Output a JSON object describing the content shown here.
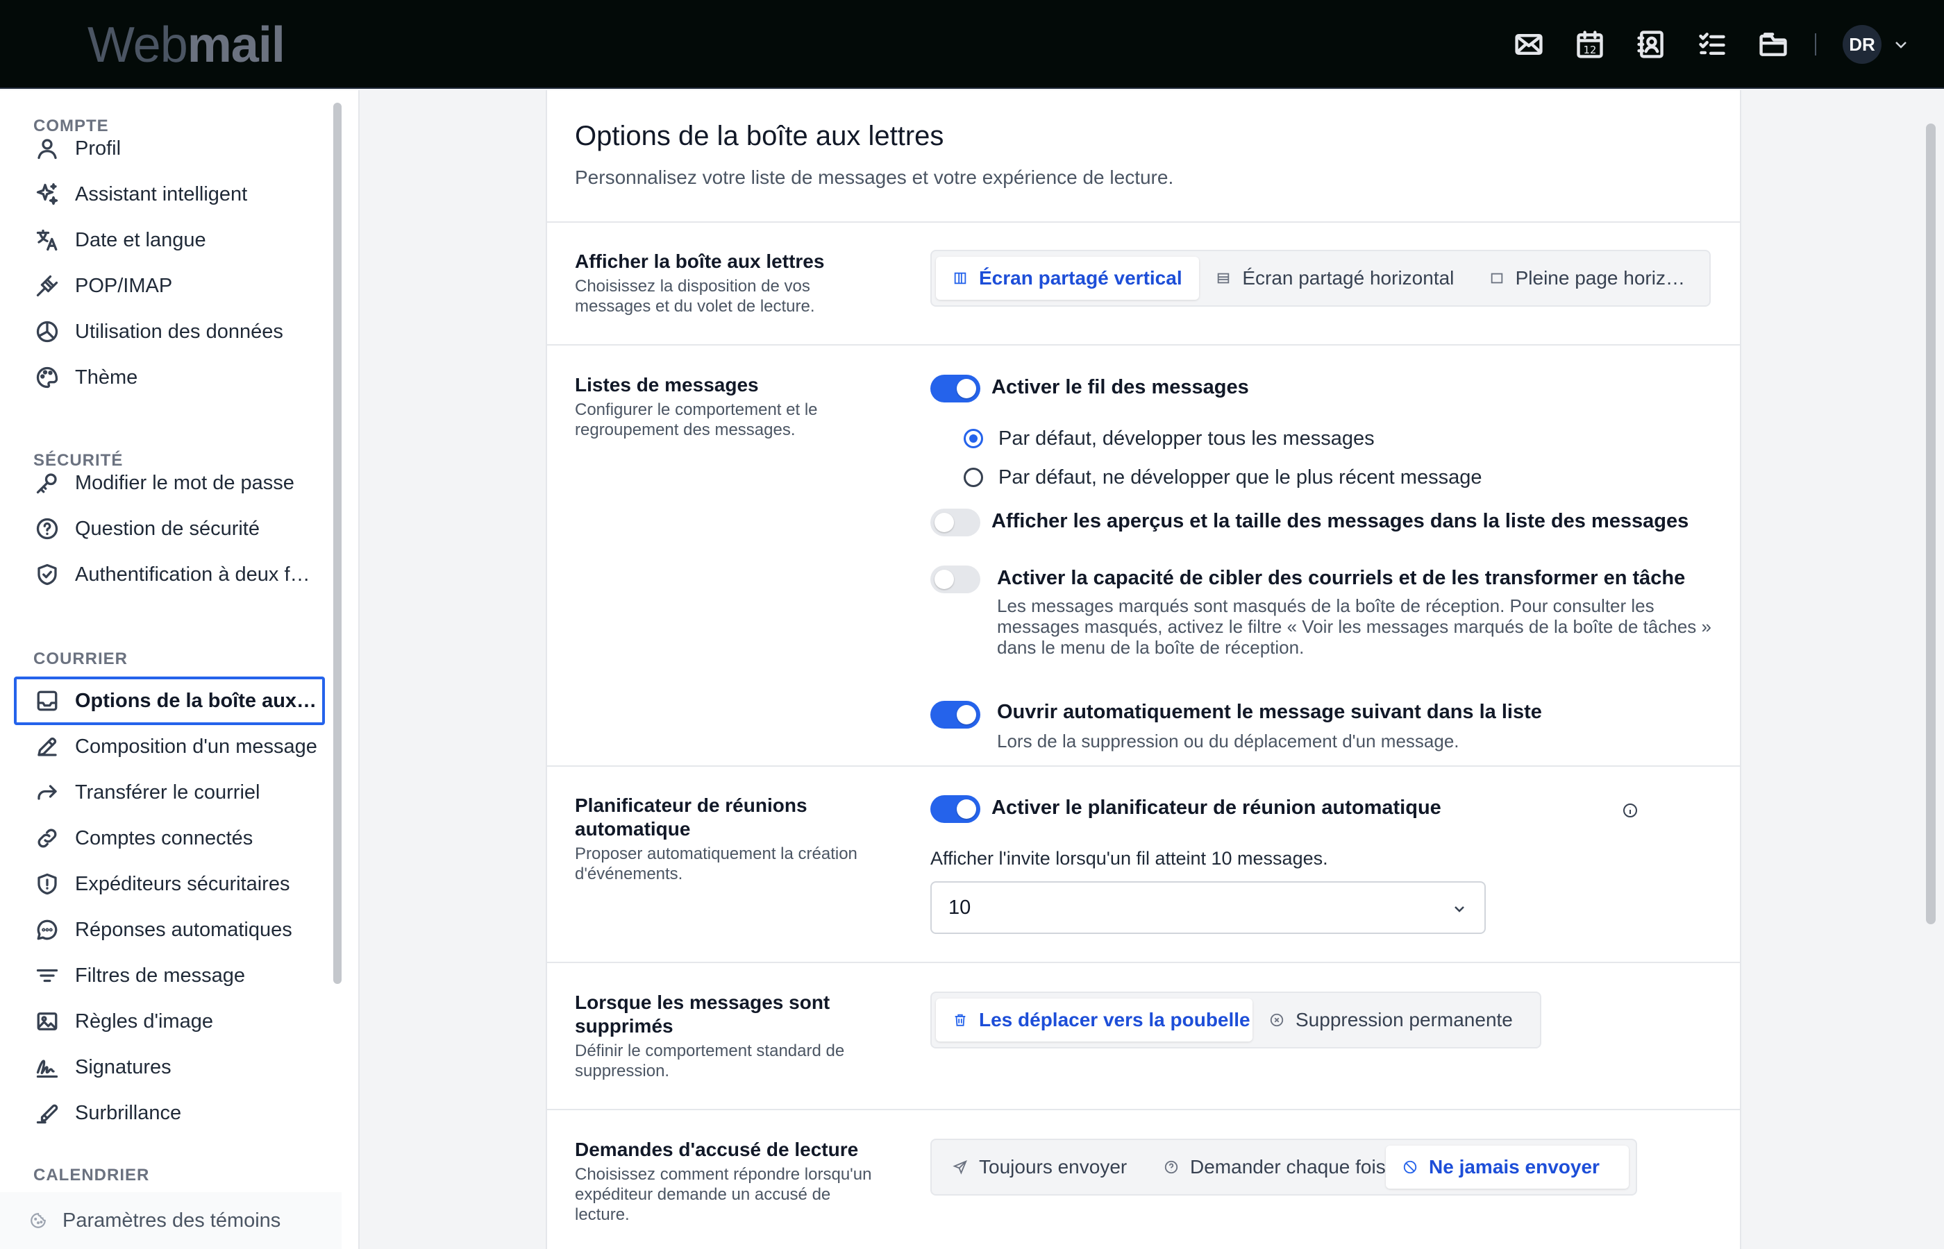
{
  "app": {
    "logo_light": "Web",
    "logo_bold": "mail",
    "avatar_initials": "DR"
  },
  "topbar_icons": [
    "mail-icon",
    "calendar-icon",
    "contacts-icon",
    "tasks-icon",
    "folder-icon"
  ],
  "calendar_day": "12",
  "sidebar": {
    "sections": {
      "compte": "COMPTE",
      "securite": "SÉCURITÉ",
      "courrier": "COURRIER",
      "calendrier": "CALENDRIER"
    },
    "compte_items": [
      {
        "label": "Profil",
        "icon": "user-icon"
      },
      {
        "label": "Assistant intelligent",
        "icon": "sparkles-icon"
      },
      {
        "label": "Date et langue",
        "icon": "translate-icon"
      },
      {
        "label": "POP/IMAP",
        "icon": "plug-icon"
      },
      {
        "label": "Utilisation des données",
        "icon": "pie-chart-icon"
      },
      {
        "label": "Thème",
        "icon": "palette-icon"
      }
    ],
    "securite_items": [
      {
        "label": "Modifier le mot de passe",
        "icon": "key-icon"
      },
      {
        "label": "Question de sécurité",
        "icon": "question-circle-icon"
      },
      {
        "label": "Authentification à deux facteurs",
        "icon": "shield-check-icon"
      }
    ],
    "courrier_items": [
      {
        "label": "Options de la boîte aux lettres",
        "icon": "inbox-icon",
        "active": true
      },
      {
        "label": "Composition d'un message",
        "icon": "pencil-icon"
      },
      {
        "label": "Transférer le courriel",
        "icon": "forward-arrow-icon"
      },
      {
        "label": "Comptes connectés",
        "icon": "link-icon"
      },
      {
        "label": "Expéditeurs sécuritaires",
        "icon": "shield-alert-icon"
      },
      {
        "label": "Réponses automatiques",
        "icon": "chat-bubble-icon"
      },
      {
        "label": "Filtres de message",
        "icon": "filter-lines-icon"
      },
      {
        "label": "Règles d'image",
        "icon": "image-icon"
      },
      {
        "label": "Signatures",
        "icon": "signature-icon"
      },
      {
        "label": "Surbrillance",
        "icon": "highlighter-icon"
      }
    ],
    "cookie_settings": "Paramètres des témoins"
  },
  "page": {
    "title": "Options de la boîte aux lettres",
    "subtitle": "Personnalisez votre liste de messages et votre expérience de lecture."
  },
  "display": {
    "title": "Afficher la boîte aux lettres",
    "desc": "Choisissez la disposition de vos messages et du volet de lecture.",
    "options": [
      "Écran partagé vertical",
      "Écran partagé horizontal",
      "Pleine page horizontale"
    ],
    "selected_index": 0
  },
  "lists": {
    "title": "Listes de messages",
    "desc": "Configurer le comportement et le regroupement des messages.",
    "threading_label": "Activer le fil des messages",
    "threading_on": true,
    "radio_expand_all": "Par défaut, développer tous les messages",
    "radio_expand_recent": "Par défaut, ne développer que le plus récent message",
    "previews_label": "Afficher les aperçus et la taille des messages dans la liste des messages",
    "previews_on": false,
    "tasks_label": "Activer la capacité de cibler des courriels et de les transformer en tâche",
    "tasks_help": "Les messages marqués sont masqués de la boîte de réception. Pour consulter les messages masqués, activez le filtre « Voir les messages marqués de la boîte de tâches » dans le menu de la boîte de réception.",
    "tasks_on": false,
    "autoopen_label": "Ouvrir automatiquement le message suivant dans la liste",
    "autoopen_help": "Lors de la suppression ou du déplacement d'un message.",
    "autoopen_on": true
  },
  "scheduler": {
    "title": "Planificateur de réunions automatique",
    "desc": "Proposer automatiquement la création d'événements.",
    "toggle_label": "Activer le planificateur de réunion automatique",
    "toggle_on": true,
    "threshold_label": "Afficher l'invite lorsqu'un fil atteint 10 messages.",
    "threshold_value": "10"
  },
  "deletion": {
    "title": "Lorsque les messages sont supprimés",
    "desc": "Définir le comportement standard de suppression.",
    "options": [
      "Les déplacer vers la poubelle",
      "Suppression permanente"
    ],
    "selected_index": 0
  },
  "receipts": {
    "title": "Demandes d'accusé de lecture",
    "desc": "Choisissez comment répondre lorsqu'un expéditeur demande un accusé de lecture.",
    "options": [
      "Toujours envoyer",
      "Demander chaque fois",
      "Ne jamais envoyer"
    ],
    "selected_index": 2
  },
  "colors": {
    "accent": "#2563eb",
    "topbar": "#030a08"
  }
}
